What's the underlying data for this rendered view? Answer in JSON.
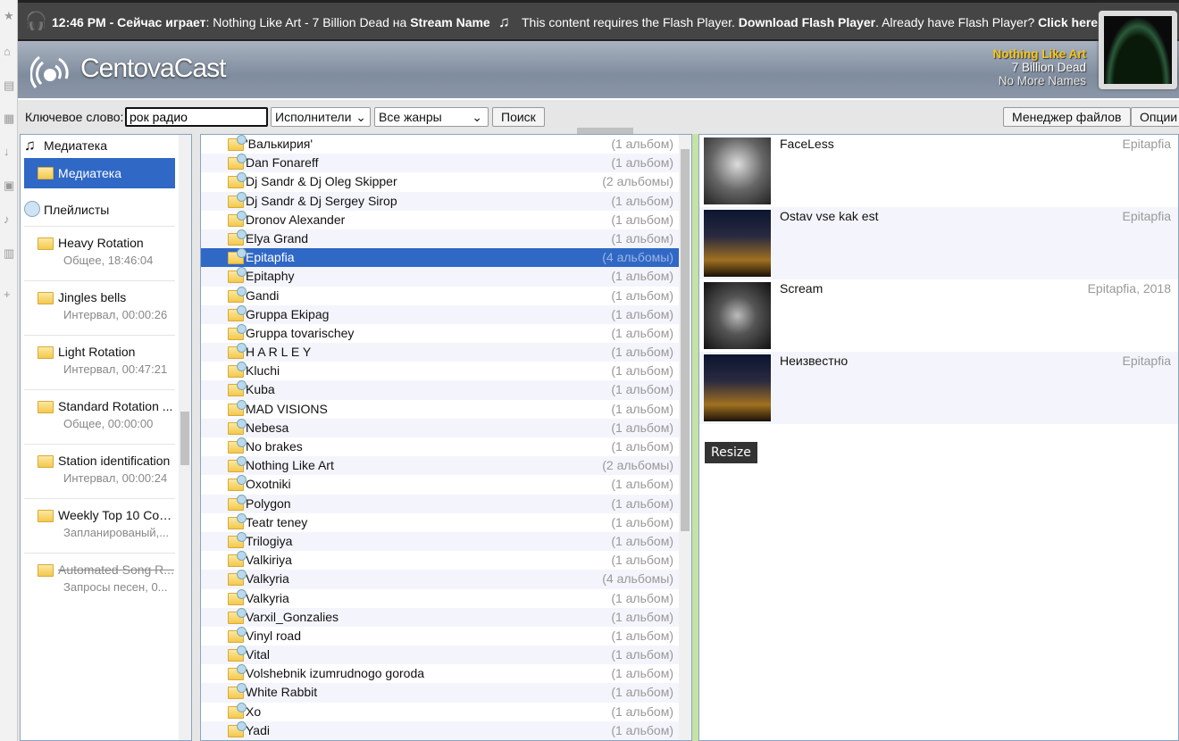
{
  "topbar": {
    "time": "12:46 PM - Сейчас играет",
    "now_playing": ": Nothing Like Art - 7 Billion Dead на ",
    "stream": "Stream Name",
    "flash_msg": "This content requires the Flash Player. ",
    "flash_download": "Download Flash Player",
    "flash_have": ". Already have Flash Player? ",
    "flash_click": "Click here."
  },
  "header": {
    "logo": "CentovaCast",
    "artist": "Nothing Like Art",
    "title": "7 Billion Dead",
    "album": "No More Names",
    "artist_color": "#f5c518"
  },
  "toolbar": {
    "keyword_label": "Ключевое слово:",
    "keyword_value": "рок радио",
    "type_select": "Исполнители",
    "genre_select": "Все жанры",
    "search": "Поиск",
    "file_manager": "Менеджер файлов",
    "options": "Опции"
  },
  "library": {
    "header": "Медиатека",
    "selected": "Медиатека",
    "playlists_header": "Плейлисты",
    "playlists": [
      {
        "name": "Heavy Rotation",
        "sub": "Общее, 18:46:04"
      },
      {
        "name": "Jingles bells",
        "sub": "Интервал, 00:00:26"
      },
      {
        "name": "Light Rotation",
        "sub": "Интервал, 00:47:21"
      },
      {
        "name": "Standard Rotation ...",
        "sub": "Общее, 00:00:00"
      },
      {
        "name": "Station identification",
        "sub": "Интервал, 00:00:24"
      },
      {
        "name": "Weekly Top 10 Cou...",
        "sub": "Запланированый,..."
      },
      {
        "name": "Automated Song R...",
        "sub": "Запросы песен, 0...",
        "disabled": true
      }
    ]
  },
  "artists": [
    {
      "name": "'Валькирия'",
      "count": "(1 альбом)"
    },
    {
      "name": "Dan Fonareff",
      "count": "(1 альбом)"
    },
    {
      "name": "Dj Sandr & Dj Oleg Skipper",
      "count": "(2 альбомы)"
    },
    {
      "name": "Dj Sandr & Dj Sergey Sirop",
      "count": "(1 альбом)"
    },
    {
      "name": "Dronov Alexander",
      "count": "(1 альбом)"
    },
    {
      "name": "Elya Grand",
      "count": "(1 альбом)"
    },
    {
      "name": "Epitapfia",
      "count": "(4 альбомы)",
      "selected": true
    },
    {
      "name": "Epitaphy",
      "count": "(1 альбом)"
    },
    {
      "name": "Gandi",
      "count": "(1 альбом)"
    },
    {
      "name": "Gruppa Ekipag",
      "count": "(1 альбом)"
    },
    {
      "name": "Gruppa tovarischey",
      "count": "(1 альбом)"
    },
    {
      "name": "H A R L E Y",
      "count": "(1 альбом)"
    },
    {
      "name": "Kluchi",
      "count": "(1 альбом)"
    },
    {
      "name": "Kuba",
      "count": "(1 альбом)"
    },
    {
      "name": "MAD VISIONS",
      "count": "(1 альбом)"
    },
    {
      "name": "Nebesa",
      "count": "(1 альбом)"
    },
    {
      "name": "No brakes",
      "count": "(1 альбом)"
    },
    {
      "name": "Nothing Like Art",
      "count": "(2 альбомы)"
    },
    {
      "name": "Oxotniki",
      "count": "(1 альбом)"
    },
    {
      "name": "Polygon",
      "count": "(1 альбом)"
    },
    {
      "name": "Teatr teney",
      "count": "(1 альбом)"
    },
    {
      "name": "Trilogiya",
      "count": "(1 альбом)"
    },
    {
      "name": "Valkiriya",
      "count": "(1 альбом)"
    },
    {
      "name": "Valkyria",
      "count": "(4 альбомы)"
    },
    {
      "name": "Valkyria",
      "count": "(1 альбом)"
    },
    {
      "name": "Varxil_Gonzalies",
      "count": "(1 альбом)"
    },
    {
      "name": "Vinyl road",
      "count": "(1 альбом)"
    },
    {
      "name": "Vital",
      "count": "(1 альбом)"
    },
    {
      "name": "Volshebnik izumrudnogo goroda",
      "count": "(1 альбом)"
    },
    {
      "name": "White Rabbit",
      "count": "(1 альбом)"
    },
    {
      "name": "Xo",
      "count": "(1 альбом)"
    },
    {
      "name": "Yadi",
      "count": "(1 альбом)"
    }
  ],
  "albums": [
    {
      "title": "FaceLess",
      "meta": "Epitapfia",
      "art": "grey"
    },
    {
      "title": "Ostav vse kak est",
      "meta": "Epitapfia",
      "art": "gold"
    },
    {
      "title": "Scream",
      "meta": "Epitapfia, 2018",
      "art": "dark"
    },
    {
      "title": "Неизвестно",
      "meta": "Epitapfia",
      "art": "gold"
    }
  ],
  "tooltip": "Resize",
  "colors": {
    "selection": "#3068c6",
    "divider": "#c6e2a6"
  }
}
